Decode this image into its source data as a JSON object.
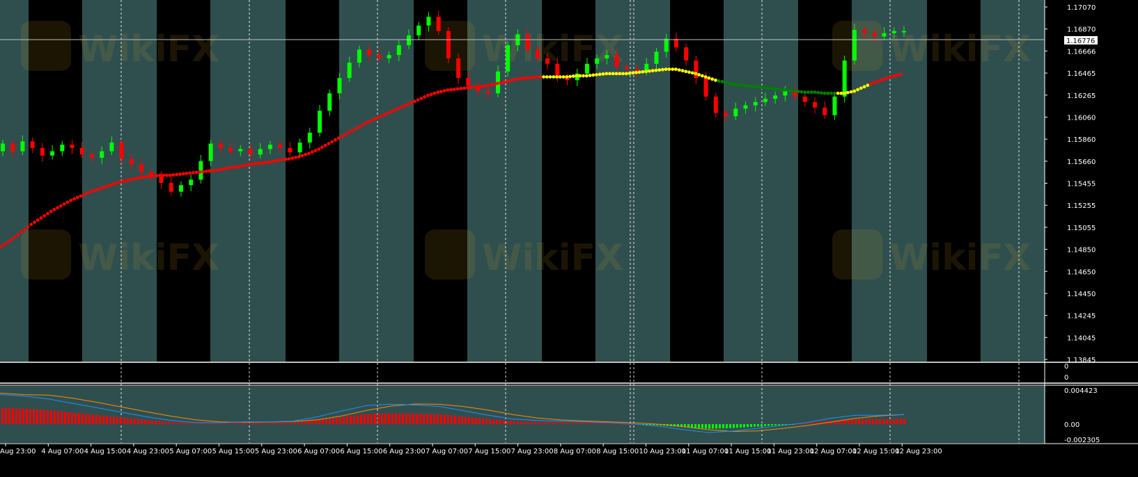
{
  "chart_data": {
    "type": "candlestick",
    "colors": {
      "bull": "#00ff00",
      "bear": "#ff0000",
      "band_light": "#2f4f4f",
      "band_dark": "#000000",
      "ma_red": "#ff0000",
      "ma_yellow": "#ffff00",
      "ma_green": "#008000",
      "grid": "#ffffff",
      "macd_line": "#1e90ff",
      "signal_line": "#ff8c00"
    },
    "price_axis": {
      "ticks": [
        "1.17070",
        "1.16870",
        "1.16666",
        "1.16465",
        "1.16265",
        "1.16060",
        "1.15860",
        "1.15660",
        "1.15455",
        "1.15255",
        "1.15055",
        "1.14850",
        "1.14650",
        "1.14450",
        "1.14245",
        "1.14045",
        "1.13845"
      ],
      "min": 1.13845,
      "max": 1.1707,
      "current": "1.16776"
    },
    "time_axis": {
      "labels": [
        "Aug 23:00",
        "4 Aug 07:00",
        "4 Aug 15:00",
        "4 Aug 23:00",
        "5 Aug 07:00",
        "5 Aug 15:00",
        "5 Aug 23:00",
        "6 Aug 07:00",
        "6 Aug 15:00",
        "6 Aug 23:00",
        "7 Aug 07:00",
        "7 Aug 15:00",
        "7 Aug 23:00",
        "8 Aug 07:00",
        "8 Aug 15:00",
        "10 Aug 23:00",
        "11 Aug 07:00",
        "11 Aug 15:00",
        "11 Aug 23:00",
        "12 Aug 07:00",
        "12 Aug 15:00",
        "12 Aug 23:00"
      ]
    },
    "mid_panel_ticks": [
      "0",
      "0"
    ],
    "macd_axis": {
      "ticks": [
        "0.004423",
        "0.00",
        "-0.002305"
      ],
      "max": 0.004423,
      "min": -0.002305
    },
    "watermark": "WikiFX",
    "close_series": [
      1.1582,
      1.1575,
      1.1584,
      1.1578,
      1.1571,
      1.1575,
      1.1581,
      1.1578,
      1.1572,
      1.1569,
      1.1575,
      1.1583,
      1.1568,
      1.1563,
      1.1556,
      1.1552,
      1.1546,
      1.1538,
      1.1544,
      1.1549,
      1.1566,
      1.1582,
      1.1578,
      1.1575,
      1.1577,
      1.1572,
      1.1577,
      1.1581,
      1.1578,
      1.1574,
      1.1583,
      1.1592,
      1.1612,
      1.1628,
      1.1642,
      1.1656,
      1.1668,
      1.1663,
      1.166,
      1.1663,
      1.1672,
      1.1681,
      1.169,
      1.1698,
      1.1685,
      1.166,
      1.1642,
      1.1635,
      1.163,
      1.1628,
      1.1648,
      1.1672,
      1.1682,
      1.1668,
      1.166,
      1.1655,
      1.1642,
      1.164,
      1.1646,
      1.1655,
      1.166,
      1.1663,
      1.1652,
      1.165,
      1.1648,
      1.1655,
      1.1666,
      1.1678,
      1.167,
      1.1658,
      1.1642,
      1.1625,
      1.161,
      1.1607,
      1.1614,
      1.1617,
      1.162,
      1.1623,
      1.1626,
      1.163,
      1.1625,
      1.162,
      1.1615,
      1.1608,
      1.1625,
      1.1658,
      1.1686,
      1.1683,
      1.168,
      1.1683,
      1.1685,
      1.1685
    ],
    "ma_series": [
      1.1488,
      1.1494,
      1.1501,
      1.1508,
      1.1514,
      1.152,
      1.1525,
      1.153,
      1.1534,
      1.1538,
      1.1541,
      1.1544,
      1.1547,
      1.1549,
      1.1551,
      1.1552,
      1.1553,
      1.1553,
      1.1554,
      1.1555,
      1.1556,
      1.1557,
      1.1558,
      1.156,
      1.1561,
      1.1563,
      1.1564,
      1.1565,
      1.1567,
      1.1568,
      1.157,
      1.1573,
      1.1577,
      1.1582,
      1.1587,
      1.1592,
      1.1597,
      1.1602,
      1.1606,
      1.161,
      1.1614,
      1.1618,
      1.1622,
      1.1626,
      1.1629,
      1.1631,
      1.1632,
      1.1633,
      1.1634,
      1.1635,
      1.1637,
      1.1639,
      1.1641,
      1.1642,
      1.1643,
      1.1643,
      1.1643,
      1.1643,
      1.1644,
      1.1644,
      1.1645,
      1.1646,
      1.1646,
      1.1646,
      1.1647,
      1.1648,
      1.1649,
      1.165,
      1.165,
      1.1648,
      1.1646,
      1.1643,
      1.164,
      1.1638,
      1.1636,
      1.1635,
      1.1634,
      1.1633,
      1.1632,
      1.1631,
      1.163,
      1.1629,
      1.1629,
      1.1628,
      1.1628,
      1.1628,
      1.163,
      1.1634,
      1.1638,
      1.1641,
      1.1644,
      1.1646
    ],
    "macd_series": [
      0.004,
      0.0038,
      0.0034,
      0.0028,
      0.0022,
      0.0016,
      0.001,
      0.0005,
      0.0002,
      0.0002,
      0.0003,
      0.0003,
      0.0004,
      0.001,
      0.0018,
      0.0025,
      0.0027,
      0.0026,
      0.0024,
      0.0018,
      0.0012,
      0.0007,
      0.0005,
      0.0004,
      0.0003,
      0.0002,
      0.0,
      -0.0003,
      -0.0008,
      -0.0012,
      -0.001,
      -0.0006,
      -0.0002,
      0.0002,
      0.0008,
      0.0012,
      0.0012,
      0.0013
    ]
  }
}
